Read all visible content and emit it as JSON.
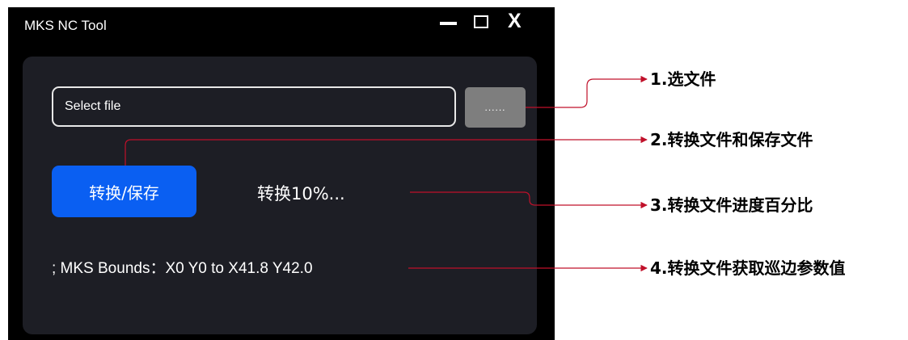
{
  "window": {
    "title": "MKS NC Tool",
    "close_glyph": "X"
  },
  "file": {
    "placeholder": "Select file",
    "browse_label": "......"
  },
  "actions": {
    "convert_label": "转换/保存",
    "progress_text": "转换10%...",
    "progress_percent": 10
  },
  "bounds_text": "; MKS Bounds：X0 Y0 to X41.8 Y42.0",
  "annotations": [
    {
      "label": "1.选文件"
    },
    {
      "label": "2.转换文件和保存文件"
    },
    {
      "label": "3.转换文件进度百分比"
    },
    {
      "label": "4.转换文件获取巡边参数值"
    }
  ],
  "colors": {
    "window_bg": "#000000",
    "panel_bg": "#1d1e25",
    "primary_button": "#0a5ff2",
    "browse_button": "#7e7e7e",
    "annotation_line": "#c0102a"
  },
  "icons": {
    "minimize": "minimize-icon",
    "maximize": "maximize-icon",
    "close": "close-icon"
  }
}
